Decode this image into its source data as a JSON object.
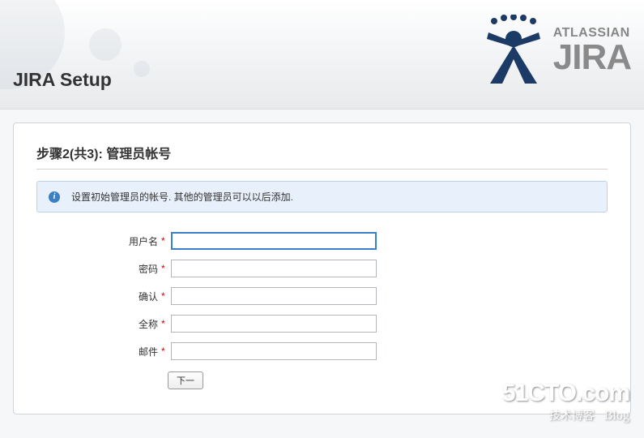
{
  "header": {
    "page_title": "JIRA Setup",
    "brand_top": "ATLASSIAN",
    "brand_bottom": "JIRA"
  },
  "panel": {
    "step_title": "步骤2(共3): 管理员帐号",
    "info_text": "设置初始管理员的帐号. 其他的管理员可以以后添加."
  },
  "form": {
    "fields": [
      {
        "label": "用户名",
        "value": "",
        "required": true,
        "focused": true
      },
      {
        "label": "密码",
        "value": "",
        "required": true,
        "focused": false
      },
      {
        "label": "确认",
        "value": "",
        "required": true,
        "focused": false
      },
      {
        "label": "全称",
        "value": "",
        "required": true,
        "focused": false
      },
      {
        "label": "邮件",
        "value": "",
        "required": true,
        "focused": false
      }
    ],
    "next_button": "下一"
  },
  "watermark": {
    "main": "51CTO.com",
    "sub": "技术博客",
    "blog": "Blog"
  }
}
